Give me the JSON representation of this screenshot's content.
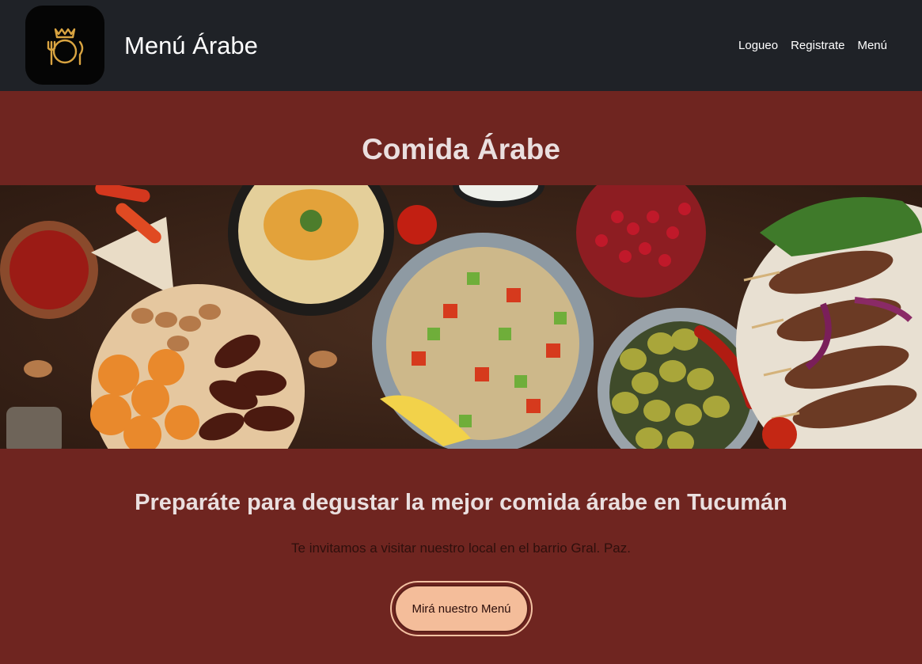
{
  "navbar": {
    "brand": "Menú Árabe",
    "links": [
      "Logueo",
      "Registrate",
      "Menú"
    ],
    "logo_icon": "crowned-plate-cutlery-icon",
    "logo_color": "#d9a441",
    "background": "#1f2227"
  },
  "hero": {
    "title": "Comida Árabe",
    "banner_image": "arabic-food-spread-image",
    "background": "#6f2520"
  },
  "content": {
    "tagline": "Preparáte para degustar la mejor comida árabe en Tucumán",
    "subtext": "Te invitamos a visitar nuestro local en el barrio Gral. Paz.",
    "cta_label": "Mirá nuestro Menú",
    "cta_color": "#f4bd9a"
  }
}
